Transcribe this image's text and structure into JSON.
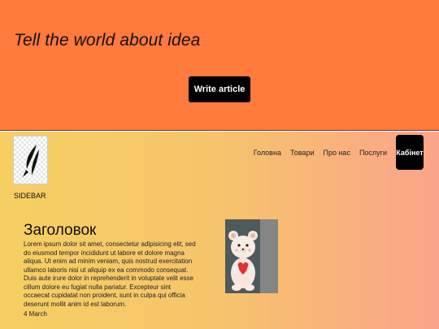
{
  "hero": {
    "title": "Tell the world about idea",
    "button": "Write article"
  },
  "sidebar": {
    "label": "SIDEBAR"
  },
  "nav": {
    "items": [
      "Головна",
      "Товари",
      "Про нас",
      "Послуги"
    ],
    "cabinet": "Кабінет"
  },
  "article": {
    "title": "Заголовок",
    "body": "Lorem ipsum dolor sit amet, consectetur adipisicing elit, sed do eiusmod tempor incididunt ut labore et dolore magna aliqua. Ut enim ad minim veniam, quis nostrud exercitation ullamco laboris nisi ut aliquip ex ea commodo consequat. Duis aute irure dolor in reprehenderit in voluptate velit esse cillum dolore eu fugiat nulla pariatur. Excepteur sint occaecat cupidatat non proident, sunt in culpa qui officia deserunt mollit anim id est laborum.",
    "date": "4 March"
  },
  "colors": {
    "hero_bg": "#ff7a3d",
    "button_bg": "#000000",
    "gradient_start": "#f6cf63",
    "gradient_end": "#fba38a"
  },
  "icons": {
    "logo": "feather-logo-icon",
    "article_image": "teddy-bear-heart-image"
  }
}
